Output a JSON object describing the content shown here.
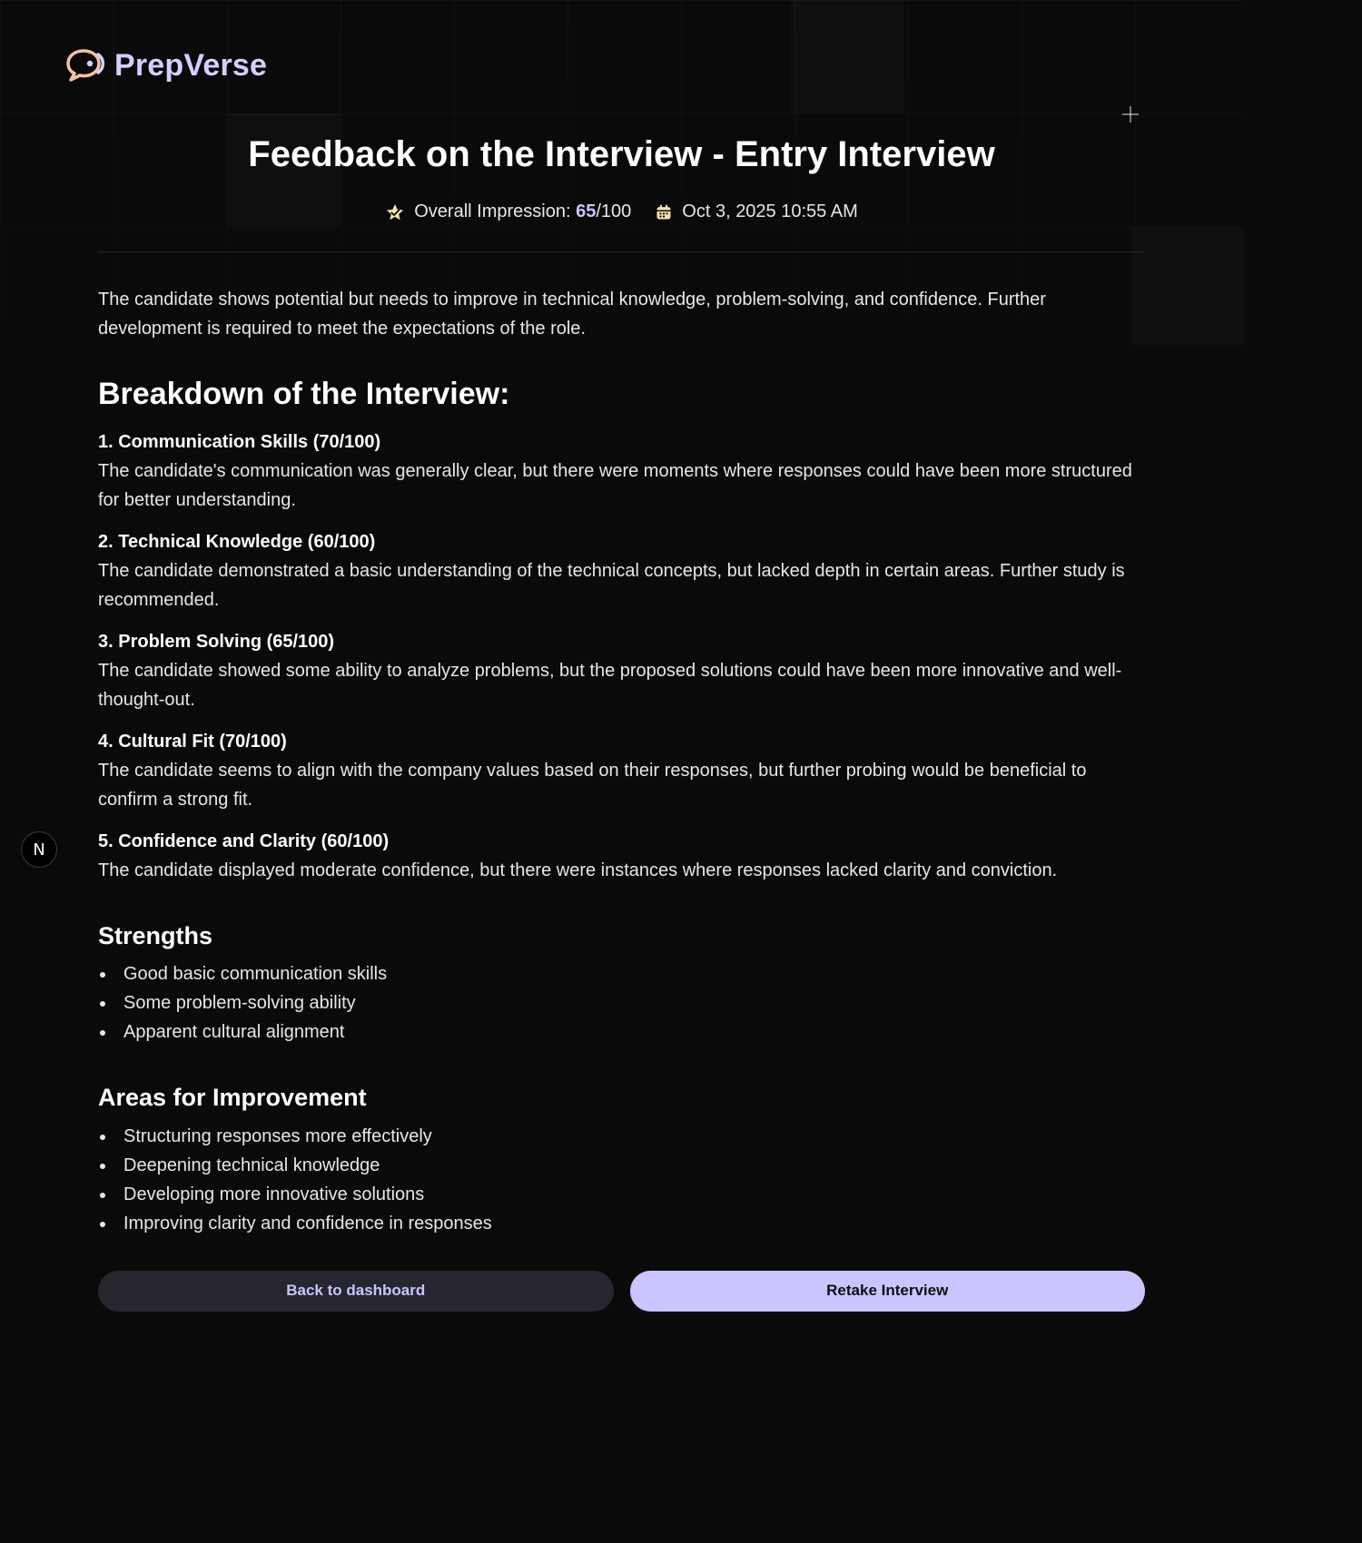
{
  "app": {
    "brand": "PrepVerse",
    "accent_color": "#cac5fe",
    "logo_icon": "chat-bubble-icon"
  },
  "feedback": {
    "title": "Feedback on the Interview - Entry Interview",
    "impression_label": "Overall Impression: ",
    "score": "65",
    "score_max": "/100",
    "date": "Oct 3, 2025 10:55 AM",
    "summary": "The candidate shows potential but needs to improve in technical knowledge, problem-solving, and confidence. Further development is required to meet the expectations of the role."
  },
  "breakdown": {
    "heading": "Breakdown of the Interview:",
    "categories": [
      {
        "title": "1. Communication Skills (70/100)",
        "comment": "The candidate's communication was generally clear, but there were moments where responses could have been more structured for better understanding."
      },
      {
        "title": "2. Technical Knowledge (60/100)",
        "comment": "The candidate demonstrated a basic understanding of the technical concepts, but lacked depth in certain areas. Further study is recommended."
      },
      {
        "title": "3. Problem Solving (65/100)",
        "comment": "The candidate showed some ability to analyze problems, but the proposed solutions could have been more innovative and well-thought-out."
      },
      {
        "title": "4. Cultural Fit (70/100)",
        "comment": "The candidate seems to align with the company values based on their responses, but further probing would be beneficial to confirm a strong fit."
      },
      {
        "title": "5. Confidence and Clarity (60/100)",
        "comment": "The candidate displayed moderate confidence, but there were instances where responses lacked clarity and conviction."
      }
    ]
  },
  "strengths": {
    "heading": "Strengths",
    "items": [
      "Good basic communication skills",
      "Some problem-solving ability",
      "Apparent cultural alignment"
    ]
  },
  "improvements": {
    "heading": "Areas for Improvement",
    "items": [
      "Structuring responses more effectively",
      "Deepening technical knowledge",
      "Developing more innovative solutions",
      "Improving clarity and confidence in responses"
    ]
  },
  "actions": {
    "back_label": "Back to dashboard",
    "retake_label": "Retake Interview"
  },
  "dev_badge": {
    "label": "N"
  }
}
